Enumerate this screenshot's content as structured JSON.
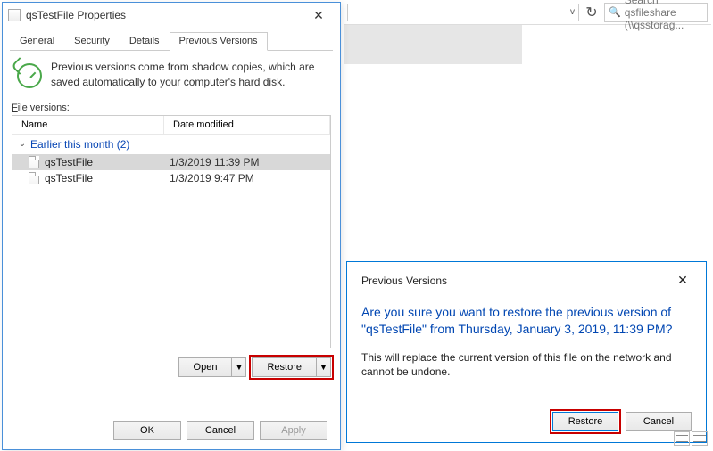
{
  "explorer": {
    "refresh_icon": "↻",
    "search_placeholder": "Search qsfileshare (\\\\qsstorag...",
    "search_icon": "🔍",
    "address_chevron": "v"
  },
  "properties": {
    "title": "qsTestFile Properties",
    "close": "✕",
    "tabs": [
      "General",
      "Security",
      "Details",
      "Previous Versions"
    ],
    "active_tab": 3,
    "info_text": "Previous versions come from shadow copies, which are saved automatically to your computer's hard disk.",
    "versions_label_prefix": "F",
    "versions_label_rest": "ile versions:",
    "columns": {
      "name": "Name",
      "date": "Date modified"
    },
    "group_label": "Earlier this month (2)",
    "group_chevron": "⌄",
    "files": [
      {
        "name": "qsTestFile",
        "date": "1/3/2019 11:39 PM",
        "selected": true
      },
      {
        "name": "qsTestFile",
        "date": "1/3/2019 9:47 PM",
        "selected": false
      }
    ],
    "open_label": "Open",
    "restore_label": "Restore",
    "drop_glyph": "▼",
    "ok_label": "OK",
    "cancel_label": "Cancel",
    "apply_label": "Apply"
  },
  "confirm": {
    "title": "Previous Versions",
    "close": "✕",
    "main_msg": "Are you sure you want to restore the previous version of \"qsTestFile\" from Thursday, January 3, 2019, 11:39 PM?",
    "sub_msg": "This will replace the current version of this file on the network and cannot be undone.",
    "restore_label": "Restore",
    "cancel_label": "Cancel"
  }
}
